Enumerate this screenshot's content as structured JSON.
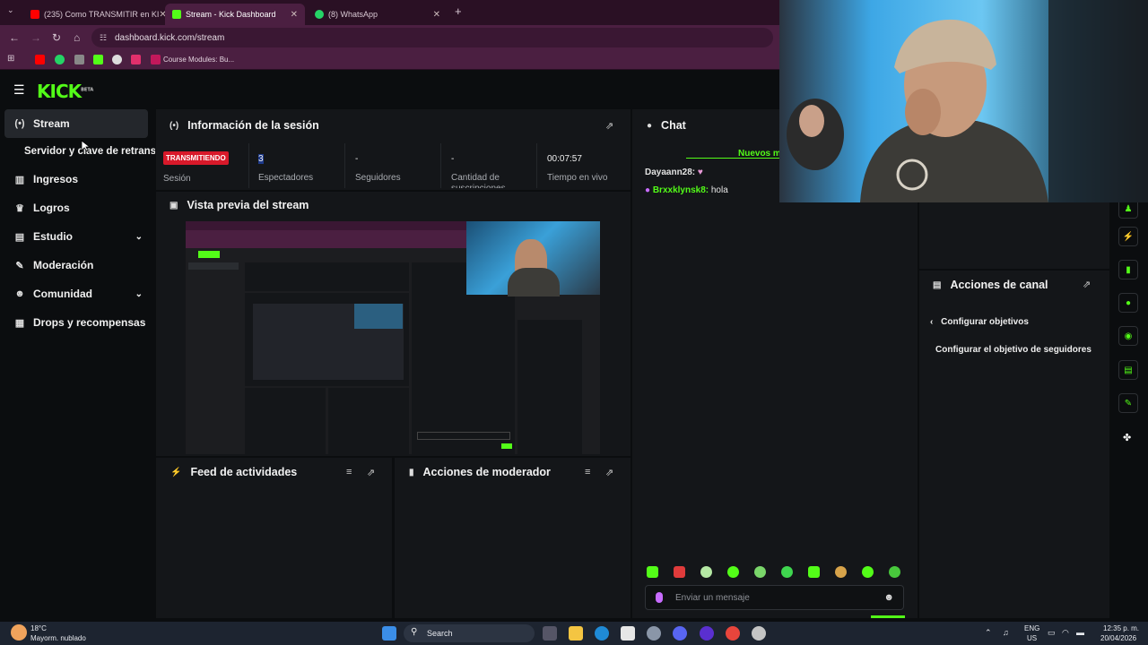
{
  "browser": {
    "tabs": [
      {
        "title": "(235) Como TRANSMITIR en KI",
        "icon": "youtube-icon",
        "color": "#ff0000"
      },
      {
        "title": "Stream - Kick Dashboard",
        "icon": "kick-icon",
        "color": "#53fc18"
      },
      {
        "title": "(8) WhatsApp",
        "icon": "whatsapp-icon",
        "color": "#25d366"
      }
    ],
    "url": "dashboard.kick.com/stream",
    "bookmark_label": "Course Modules: Bu..."
  },
  "kick": {
    "logo": "KICK",
    "logo_badge": "BETA",
    "accent": "#53fc18"
  },
  "sidebar": {
    "items": [
      {
        "label": "Stream",
        "icon": "broadcast-icon"
      },
      {
        "label": "Servidor y clave de retransm",
        "icon": ""
      },
      {
        "label": "Ingresos",
        "icon": "chart-icon"
      },
      {
        "label": "Logros",
        "icon": "trophy-icon"
      },
      {
        "label": "Estudio",
        "icon": "layout-icon"
      },
      {
        "label": "Moderación",
        "icon": "wrench-icon"
      },
      {
        "label": "Comunidad",
        "icon": "people-icon"
      },
      {
        "label": "Drops y recompensas",
        "icon": "gift-icon"
      }
    ]
  },
  "session": {
    "title": "Información de la sesión",
    "live_badge": "TRANSMITIENDO",
    "session_label": "Sesión",
    "stats": [
      {
        "value": "3",
        "label": "Espectadores"
      },
      {
        "value": "-",
        "label": "Seguidores"
      },
      {
        "value": "-",
        "label": "Cantidad de suscripciones"
      },
      {
        "value": "00:07:57",
        "label": "Tiempo en vivo"
      }
    ]
  },
  "preview": {
    "title": "Vista previa del stream"
  },
  "activity": {
    "title": "Feed de actividades"
  },
  "mod_actions": {
    "title": "Acciones de moderador"
  },
  "chat": {
    "title": "Chat",
    "new_messages": "Nuevos m",
    "messages": [
      {
        "user": "Dayaann28:",
        "text": "",
        "color": "#e2e2e2"
      },
      {
        "user": "Brxxklynsk8:",
        "text": "hola",
        "color": "#53fc18"
      }
    ],
    "input_placeholder": "Enviar un mensaje"
  },
  "channel_actions": {
    "title": "Acciones de canal",
    "back_label": "Configurar objetivos",
    "item": "Configurar el objetivo de seguidores"
  },
  "taskbar": {
    "weather_temp": "18°C",
    "weather_desc": "Mayorm. nublado",
    "search": "Search",
    "lang": "ENG",
    "region": "US",
    "time": "12:35 p. m.",
    "date": "20/04/2026"
  }
}
